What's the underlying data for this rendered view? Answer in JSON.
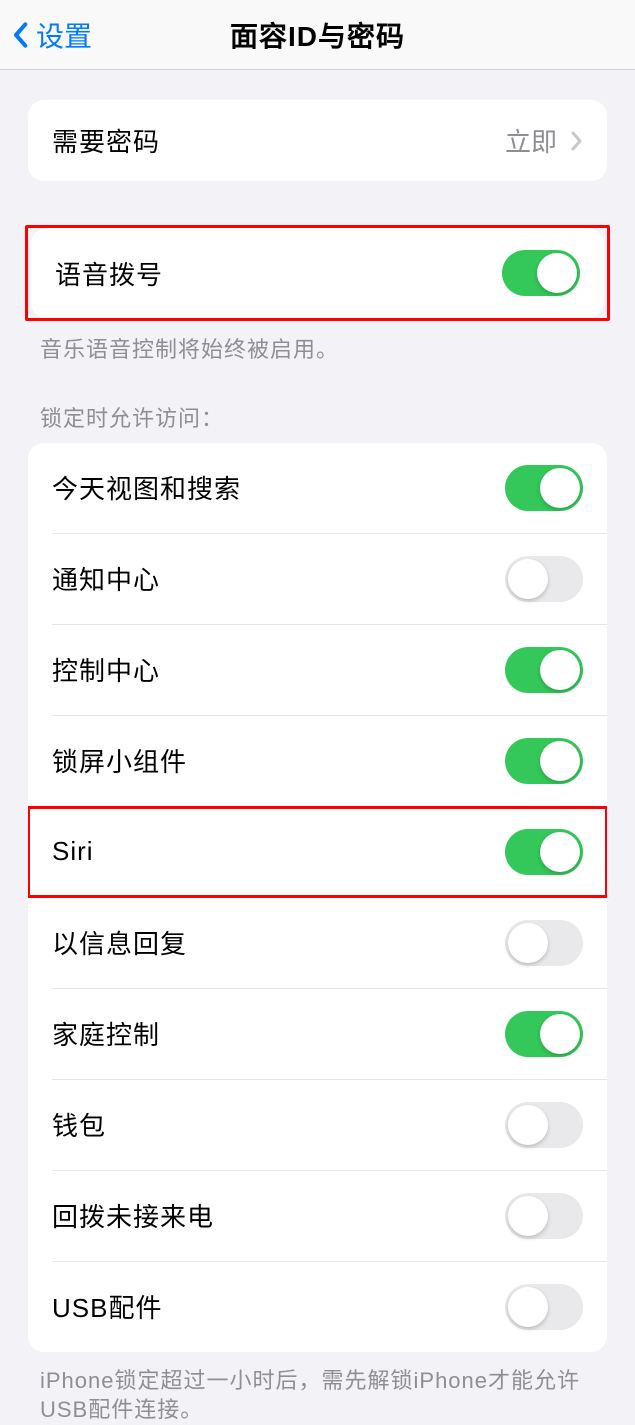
{
  "header": {
    "back_label": "设置",
    "title": "面容ID与密码"
  },
  "passcode": {
    "require_label": "需要密码",
    "require_value": "立即"
  },
  "voice_dial": {
    "label": "语音拨号",
    "on": true,
    "footer": "音乐语音控制将始终被启用。"
  },
  "lock_access": {
    "section_header": "锁定时允许访问：",
    "items": [
      {
        "label": "今天视图和搜索",
        "on": true
      },
      {
        "label": "通知中心",
        "on": false
      },
      {
        "label": "控制中心",
        "on": true
      },
      {
        "label": "锁屏小组件",
        "on": true
      },
      {
        "label": "Siri",
        "on": true
      },
      {
        "label": "以信息回复",
        "on": false
      },
      {
        "label": "家庭控制",
        "on": true
      },
      {
        "label": "钱包",
        "on": false
      },
      {
        "label": "回拨未接来电",
        "on": false
      },
      {
        "label": "USB配件",
        "on": false
      }
    ],
    "footer": "iPhone锁定超过一小时后，需先解锁iPhone才能允许USB配件连接。"
  }
}
